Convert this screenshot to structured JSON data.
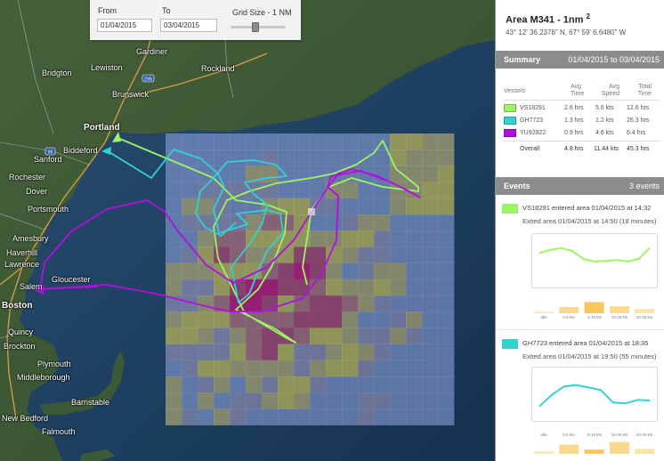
{
  "controls": {
    "from_label": "From",
    "from_value": "01/04/2015",
    "to_label": "To",
    "to_value": "03/04/2015",
    "grid_size_label": "Grid Size - 1 NM",
    "grid_level": 0.45
  },
  "map": {
    "places": [
      "Lewiston",
      "Gardiner",
      "Rockland",
      "Bridgton",
      "Brunswick",
      "Portland",
      "Biddeford",
      "Sanford",
      "Rochester",
      "Dover",
      "Portsmouth",
      "Amesbury",
      "Haverhill",
      "Lawrence",
      "Gloucester",
      "Salem",
      "Boston",
      "Quincy",
      "Brockton",
      "Plymouth",
      "Middleborough",
      "Barnstable",
      "New Bedford",
      "Falmouth"
    ],
    "highway_shields": [
      "295",
      "95"
    ]
  },
  "panel": {
    "area_title": "Area M341 - 1nm",
    "area_sup": "2",
    "area_coords": "43° 12' 36.2376\" N, 67° 59' 6.6480\" W",
    "summary_title": "Summary",
    "summary_range": "01/04/2015 to 03/04/2015",
    "table": {
      "headers": [
        "Vessels",
        "Avg Time",
        "Avg Speed",
        "Total Time"
      ],
      "rows": [
        {
          "vessel": "VS18291",
          "avg_time": "2.6 hrs",
          "avg_speed": "5.6 kts",
          "total_time": "12.6 hrs",
          "color": "#9cf564"
        },
        {
          "vessel": "GH7723",
          "avg_time": "1.3 hrs",
          "avg_speed": "1.2 kts",
          "total_time": "26.3 hrs",
          "color": "#33d0d4"
        },
        {
          "vessel": "YU92922",
          "avg_time": "0.9 hrs",
          "avg_speed": "4.6 kts",
          "total_time": "6.4 hrs",
          "color": "#b10fe0"
        }
      ],
      "overall": {
        "label": "Overall",
        "avg_time": "4.8 hrs",
        "avg_speed": "11.44 kts",
        "total_time": "45.3 hrs"
      }
    },
    "events_title": "Events",
    "events_count": "3 events",
    "events": [
      {
        "line1": "VS18291 entered area 01/04/2015 at 14:32",
        "line2": "Exited area 01/04/2015 at 14:50 (18 minutes)",
        "color": "#9cf564",
        "speed_trace": [
          0.62,
          0.68,
          0.72,
          0.66,
          0.5,
          0.45,
          0.46,
          0.48,
          0.45,
          0.5,
          0.72
        ],
        "bins": [
          "Idle",
          "0-5 kts",
          "5-10 kts",
          "10-20 kts",
          "10-20 kts"
        ],
        "bin_values": [
          0.15,
          0.5,
          0.9,
          0.55,
          0.35
        ]
      },
      {
        "line1": "GH7723 entered area 01/04/2015 at 18:35",
        "line2": "Exited area 01/04/2015 at 19:50 (55 minutes)",
        "color": "#33d0d4",
        "speed_trace": [
          0.22,
          0.45,
          0.62,
          0.65,
          0.6,
          0.55,
          0.3,
          0.28,
          0.35,
          0.34
        ],
        "bins": [
          "Idle",
          "0-5 kts",
          "5-10 kts",
          "10-20 kts",
          "10-20 kts"
        ],
        "bin_values": [
          0.2,
          0.75,
          0.35,
          0.95,
          0.4
        ]
      }
    ]
  }
}
